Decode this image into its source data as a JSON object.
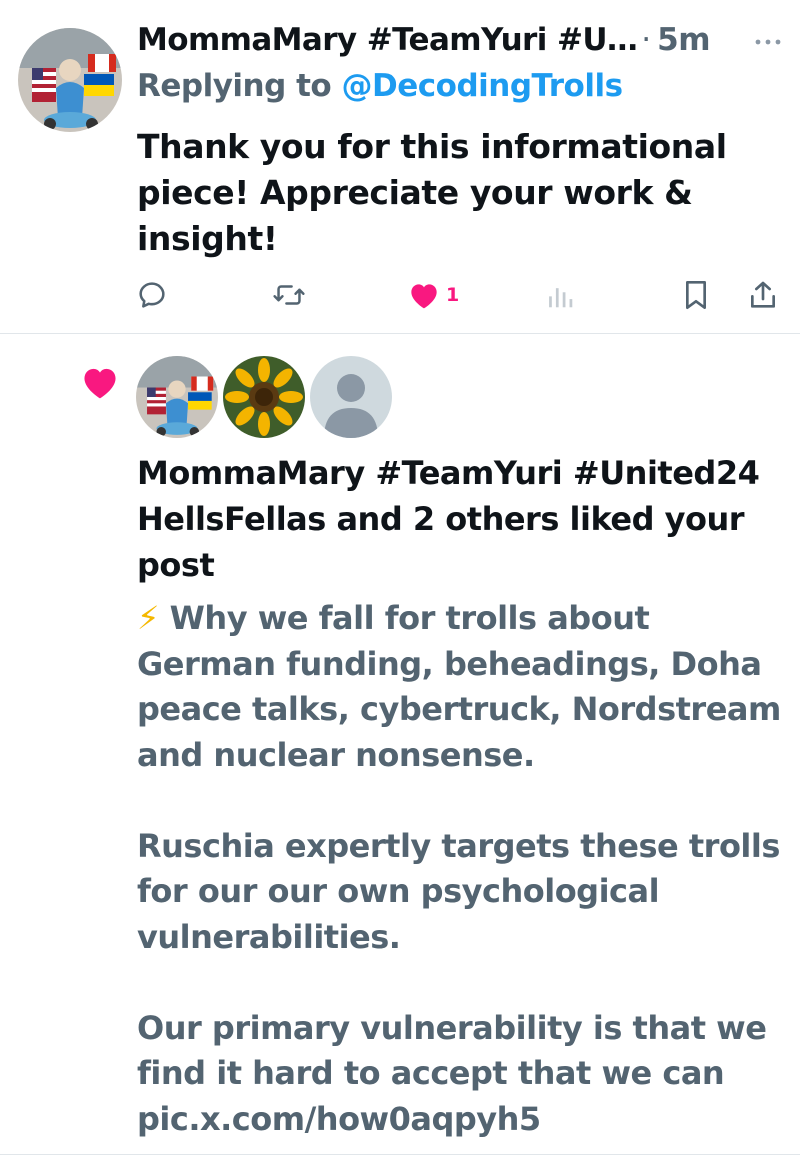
{
  "reply": {
    "author": "MommaMary #TeamYuri #U…",
    "separator": "·",
    "time": "5m",
    "replying_prefix": "Replying to ",
    "replying_handle": "@DecodingTrolls",
    "text": "Thank you for this informational piece! Appreciate your work & insight!",
    "actions": {
      "reply_icon": "comment-icon",
      "retweet_icon": "retweet-icon",
      "like_icon": "heart-icon",
      "like_count": "1",
      "views_icon": "analytics-icon",
      "bookmark_icon": "bookmark-icon",
      "share_icon": "share-icon"
    },
    "more_icon": "more-icon"
  },
  "notification": {
    "icon": "heart-icon",
    "avatars": [
      "mommamary-avatar",
      "sunflower-avatar",
      "default-avatar"
    ],
    "title": "MommaMary #TeamYuri #United24 HellsFellas and 2 others liked your post",
    "post_emoji": "⚡",
    "post_paragraphs": [
      "Why we fall for trolls about German funding, beheadings, Doha peace talks, cybertruck, Nordstream and nuclear nonsense.",
      "Ruschia expertly targets these trolls for our our own psychological vulnerabilities.",
      "Our primary vulnerability is that we find it hard to accept that we can pic.x.com/how0aqpyh5"
    ]
  },
  "colors": {
    "text": "#0f1419",
    "secondary": "#536471",
    "link": "#1d9bf0",
    "like": "#f91880",
    "lightning": "#f5b800",
    "divider": "#e1e6ea"
  }
}
